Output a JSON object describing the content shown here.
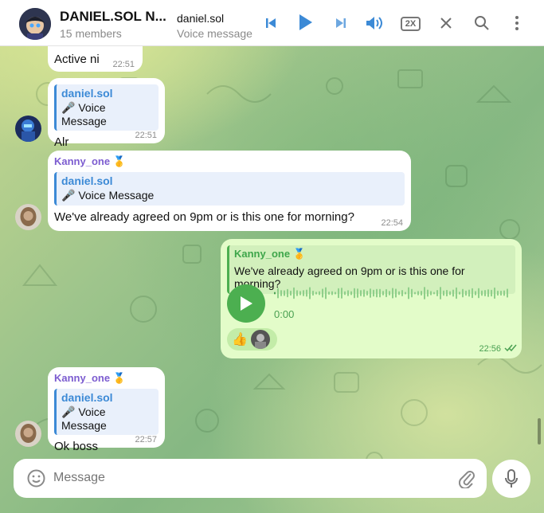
{
  "header": {
    "chat_title": "DANIEL.SOL N...",
    "chat_subtitle": "15 members",
    "audio_title": "daniel.sol",
    "audio_subtitle": "Voice message",
    "speed_label": "2X",
    "icons": [
      "skip-previous-icon",
      "play-icon",
      "skip-next-icon",
      "volume-icon",
      "speed-icon",
      "close-icon",
      "search-icon",
      "more-vertical-icon"
    ]
  },
  "messages": [
    {
      "text": "Active ni",
      "time": "22:51"
    },
    {
      "reply_name": "daniel.sol",
      "reply_text": "🎤 Voice Message",
      "text": "Alr",
      "time": "22:51"
    },
    {
      "sender": "Kanny_one 🥇",
      "reply_name": "daniel.sol",
      "reply_text": "🎤 Voice Message",
      "text": "We've already agreed on 9pm or is this one for morning?",
      "time": "22:54"
    },
    {
      "sender": "Kanny_one 🥇",
      "reply_text": "We've already agreed on 9pm or is this one for morning?",
      "voice_duration": "0:00",
      "reaction": "👍",
      "time": "22:56"
    },
    {
      "sender": "Kanny_one 🥇",
      "reply_name": "daniel.sol",
      "reply_text": "🎤 Voice Message",
      "text": "Ok boss",
      "time": "22:57"
    }
  ],
  "composer": {
    "placeholder": "Message"
  },
  "colors": {
    "accent": "#3c8ad6",
    "outgoing_bubble": "#e3fcc9",
    "voice_play": "#4caf50",
    "sender_name": "#7c5cd0"
  }
}
